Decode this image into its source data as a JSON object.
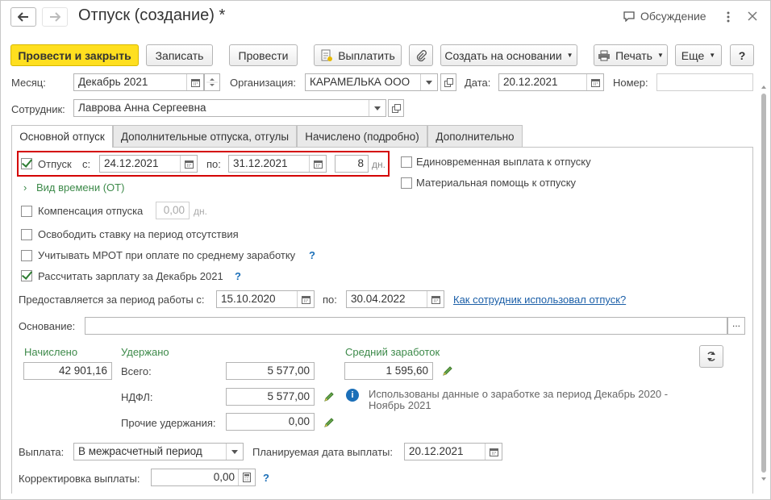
{
  "window": {
    "title": "Отпуск (создание) *",
    "discussion_label": "Обсуждение"
  },
  "toolbar": {
    "post_and_close": "Провести и закрыть",
    "save": "Записать",
    "post": "Провести",
    "pay": "Выплатить",
    "create_based_on": "Создать на основании",
    "print": "Печать",
    "more": "Еще",
    "help": "?"
  },
  "header": {
    "month_label": "Месяц:",
    "month_value": "Декабрь 2021",
    "org_label": "Организация:",
    "org_value": "КАРАМЕЛЬКА ООО",
    "date_label": "Дата:",
    "date_value": "20.12.2021",
    "number_label": "Номер:",
    "number_value": "",
    "employee_label": "Сотрудник:",
    "employee_value": "Лаврова Анна Сергеевна"
  },
  "tabs": [
    {
      "label": "Основной отпуск"
    },
    {
      "label": "Дополнительные отпуска, отгулы"
    },
    {
      "label": "Начислено (подробно)"
    },
    {
      "label": "Дополнительно"
    }
  ],
  "vacation": {
    "checkbox_label": "Отпуск",
    "from_label": "с:",
    "from_value": "24.12.2021",
    "to_label": "по:",
    "to_value": "31.12.2021",
    "days_value": "8",
    "days_unit": "дн.",
    "time_type_link": "Вид времени (ОТ)",
    "lump_sum_label": "Единовременная выплата к отпуску",
    "material_aid_label": "Материальная помощь к отпуску"
  },
  "options": {
    "compensation_label": "Компенсация отпуска",
    "compensation_value": "0,00",
    "compensation_unit": "дн.",
    "free_rate_label": "Освободить ставку на период отсутствия",
    "mrot_label": "Учитывать МРОТ при оплате по среднему заработку",
    "calc_salary_label": "Рассчитать зарплату за Декабрь 2021",
    "help_mark": "?"
  },
  "work_period": {
    "label": "Предоставляется за период работы с:",
    "from_value": "15.10.2020",
    "to_label": "по:",
    "to_value": "30.04.2022",
    "link": "Как сотрудник использовал отпуск?"
  },
  "basis": {
    "label": "Основание:",
    "value": "",
    "more_button": "..."
  },
  "totals": {
    "accrued_label": "Начислено",
    "accrued_value": "42 901,16",
    "withheld_label": "Удержано",
    "total_label": "Всего:",
    "total_value": "5 577,00",
    "ndfl_label": "НДФЛ:",
    "ndfl_value": "5 577,00",
    "other_label": "Прочие удержания:",
    "other_value": "0,00",
    "avg_label": "Средний заработок",
    "avg_value": "1 595,60",
    "info_text_1": "Использованы данные о заработке за период Декабрь 2020 -",
    "info_text_2": "Ноябрь 2021"
  },
  "payment": {
    "label": "Выплата:",
    "value": "В межрасчетный период",
    "planned_label": "Планируемая дата выплаты:",
    "planned_value": "20.12.2021",
    "correction_label": "Корректировка выплаты:",
    "correction_value": "0,00"
  },
  "colors": {
    "primary_button": "#ffdf1f",
    "accent_green": "#3d8a4a",
    "link_blue": "#1b5fa8",
    "highlight_red": "#d40000"
  }
}
